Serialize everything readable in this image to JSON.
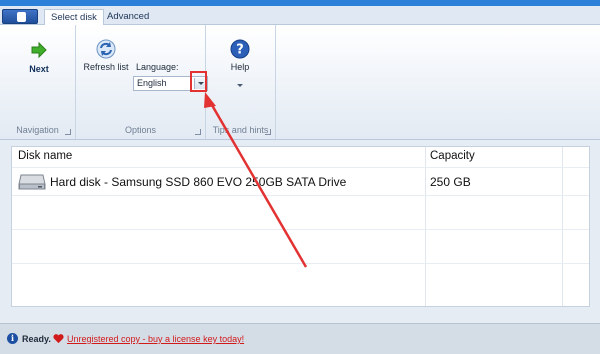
{
  "tabs": [
    {
      "label": "Select disk",
      "active": true
    },
    {
      "label": "Advanced",
      "active": false
    }
  ],
  "ribbon": {
    "navigation": {
      "group_label": "Navigation",
      "next_label": "Next"
    },
    "options": {
      "group_label": "Options",
      "refresh_label": "Refresh list",
      "language_label": "Language:",
      "language_value": "English"
    },
    "tips": {
      "group_label": "Tips and hints",
      "help_label": "Help"
    }
  },
  "disk_list": {
    "columns": [
      "Disk name",
      "Capacity"
    ],
    "rows": [
      {
        "name": "Hard disk - Samsung SSD 860 EVO 250GB SATA Drive",
        "capacity": "250 GB"
      }
    ]
  },
  "status": {
    "ready": "Ready.",
    "license_link": "Unregistered copy - buy a license key today!"
  },
  "colors": {
    "accent": "#2d80d8",
    "annotation_red": "#e23232",
    "link_red": "#d11b1b"
  },
  "icons": {
    "next": "green-arrow-icon",
    "refresh": "refresh-icon",
    "help": "help-icon",
    "disk": "hard-disk-icon",
    "ready": "info-icon",
    "license": "heart-icon"
  }
}
